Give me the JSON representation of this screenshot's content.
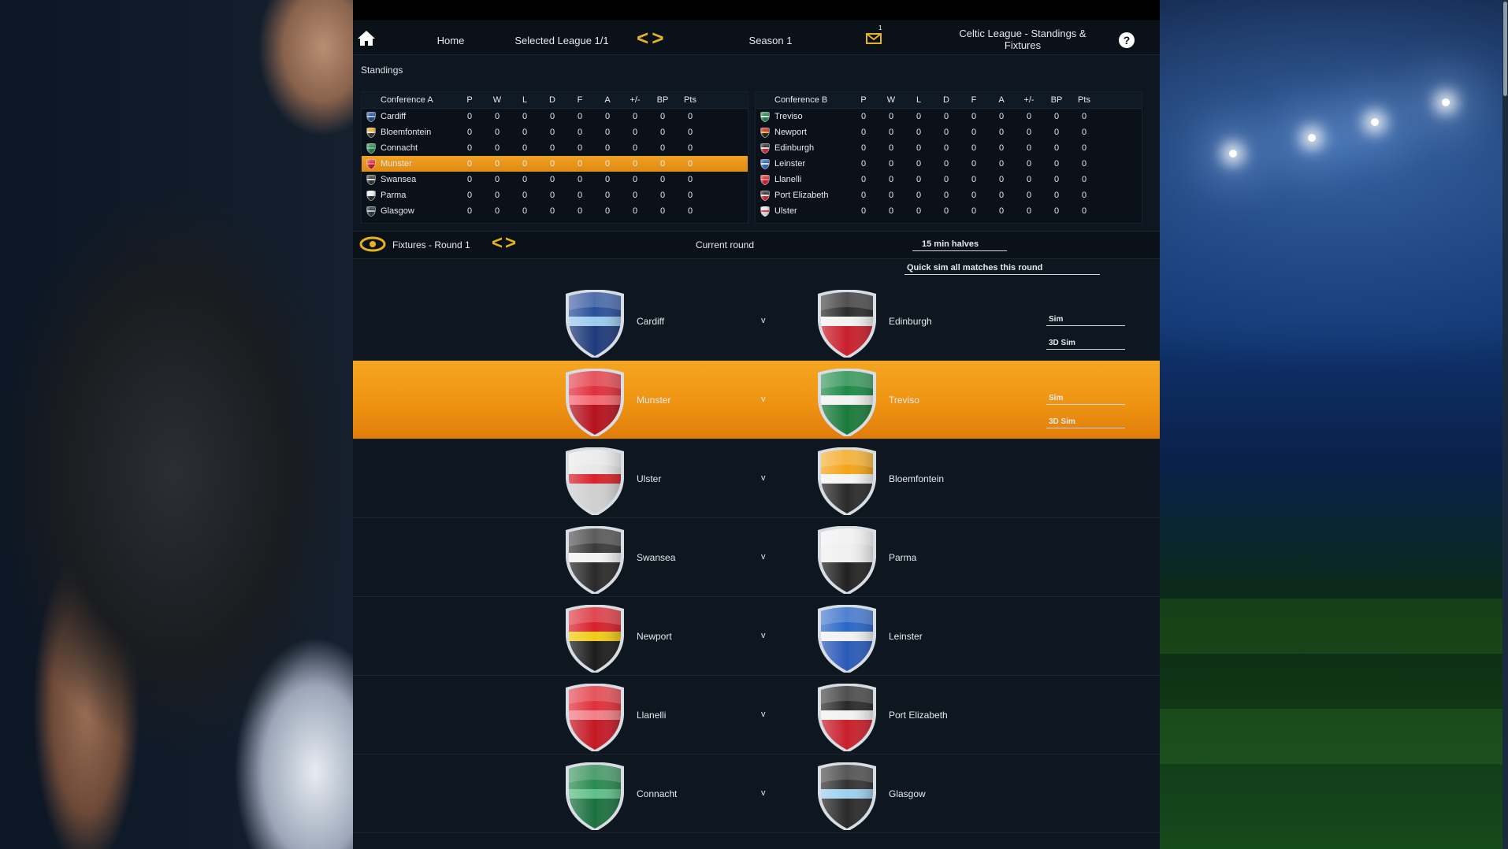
{
  "colors": {
    "accent": "#e8b21a",
    "selected_row": "#f0a123",
    "panel": "#0e1620"
  },
  "topbar": {
    "home": "Home",
    "league": "Selected League 1/1",
    "season": "Season 1",
    "mail_count": "1",
    "title_line1": "Celtic League - Standings &",
    "title_line2": "Fixtures",
    "help": "?"
  },
  "standings": {
    "title": "Standings",
    "columns": [
      "P",
      "W",
      "L",
      "D",
      "F",
      "A",
      "+/-",
      "BP",
      "Pts"
    ],
    "conference_a": {
      "name": "Conference A",
      "rows": [
        {
          "team": "Cardiff",
          "v": [
            "0",
            "0",
            "0",
            "0",
            "0",
            "0",
            "0",
            "0",
            "0"
          ]
        },
        {
          "team": "Bloemfontein",
          "v": [
            "0",
            "0",
            "0",
            "0",
            "0",
            "0",
            "0",
            "0",
            "0"
          ]
        },
        {
          "team": "Connacht",
          "v": [
            "0",
            "0",
            "0",
            "0",
            "0",
            "0",
            "0",
            "0",
            "0"
          ]
        },
        {
          "team": "Munster",
          "v": [
            "0",
            "0",
            "0",
            "0",
            "0",
            "0",
            "0",
            "0",
            "0"
          ]
        },
        {
          "team": "Swansea",
          "v": [
            "0",
            "0",
            "0",
            "0",
            "0",
            "0",
            "0",
            "0",
            "0"
          ]
        },
        {
          "team": "Parma",
          "v": [
            "0",
            "0",
            "0",
            "0",
            "0",
            "0",
            "0",
            "0",
            "0"
          ]
        },
        {
          "team": "Glasgow",
          "v": [
            "0",
            "0",
            "0",
            "0",
            "0",
            "0",
            "0",
            "0",
            "0"
          ]
        }
      ]
    },
    "conference_b": {
      "name": "Conference B",
      "rows": [
        {
          "team": "Treviso",
          "v": [
            "0",
            "0",
            "0",
            "0",
            "0",
            "0",
            "0",
            "0",
            "0"
          ]
        },
        {
          "team": "Newport",
          "v": [
            "0",
            "0",
            "0",
            "0",
            "0",
            "0",
            "0",
            "0",
            "0"
          ]
        },
        {
          "team": "Edinburgh",
          "v": [
            "0",
            "0",
            "0",
            "0",
            "0",
            "0",
            "0",
            "0",
            "0"
          ]
        },
        {
          "team": "Leinster",
          "v": [
            "0",
            "0",
            "0",
            "0",
            "0",
            "0",
            "0",
            "0",
            "0"
          ]
        },
        {
          "team": "Llanelli",
          "v": [
            "0",
            "0",
            "0",
            "0",
            "0",
            "0",
            "0",
            "0",
            "0"
          ]
        },
        {
          "team": "Port Elizabeth",
          "v": [
            "0",
            "0",
            "0",
            "0",
            "0",
            "0",
            "0",
            "0",
            "0"
          ]
        },
        {
          "team": "Ulster",
          "v": [
            "0",
            "0",
            "0",
            "0",
            "0",
            "0",
            "0",
            "0",
            "0"
          ]
        }
      ]
    }
  },
  "fixtures_bar": {
    "label": "Fixtures - Round 1",
    "current": "Current round",
    "halves": "15 min halves",
    "quick_sim": "Quick sim all matches this round"
  },
  "fixtures": [
    {
      "home": "Cardiff",
      "away": "Edinburgh",
      "v": "v",
      "sim": "Sim",
      "sim3d": "3D Sim"
    },
    {
      "home": "Munster",
      "away": "Treviso",
      "v": "v",
      "sim": "Sim",
      "sim3d": "3D Sim"
    },
    {
      "home": "Ulster",
      "away": "Bloemfontein",
      "v": "v"
    },
    {
      "home": "Swansea",
      "away": "Parma",
      "v": "v"
    },
    {
      "home": "Newport",
      "away": "Leinster",
      "v": "v"
    },
    {
      "home": "Llanelli",
      "away": "Port Elizabeth",
      "v": "v"
    },
    {
      "home": "Connacht",
      "away": "Glasgow",
      "v": "v"
    }
  ],
  "team_colors": {
    "Cardiff": [
      "#2a4f9a",
      "#9ccbef",
      "#1e3a7a"
    ],
    "Edinburgh": [
      "#2c2c2c",
      "#f2f2f2",
      "#c8202c"
    ],
    "Munster": [
      "#e0303c",
      "#f26a72",
      "#b5121c"
    ],
    "Treviso": [
      "#1e8a48",
      "#f2f2f2",
      "#1a7a3c"
    ],
    "Ulster": [
      "#e8e8e8",
      "#d8222c",
      "#cfcfcf"
    ],
    "Bloemfontein": [
      "#f4a418",
      "#f4f4f4",
      "#2a2a2a"
    ],
    "Swansea": [
      "#3a3a3a",
      "#f2f2f2",
      "#2a2a2a"
    ],
    "Parma": [
      "#f0f0f0",
      "#f0f0f0",
      "#222222"
    ],
    "Newport": [
      "#d8202a",
      "#f0cc18",
      "#1c1c1c"
    ],
    "Leinster": [
      "#2a66c8",
      "#f2f2f2",
      "#2a5ab8"
    ],
    "Llanelli": [
      "#e0303a",
      "#f08088",
      "#c41824"
    ],
    "Port Elizabeth": [
      "#2a2a2a",
      "#f2f2f2",
      "#c8202c"
    ],
    "Connacht": [
      "#2a8a50",
      "#5fc08a",
      "#1c7040"
    ],
    "Glasgow": [
      "#333333",
      "#9fd0ee",
      "#2a2a2a"
    ]
  }
}
